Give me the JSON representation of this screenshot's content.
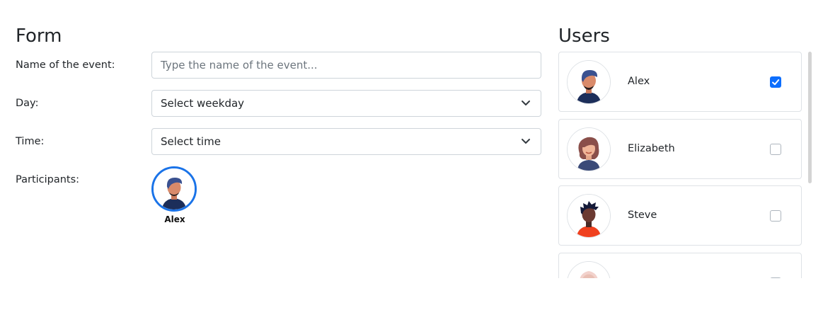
{
  "form": {
    "title": "Form",
    "event_name": {
      "label": "Name of the event:",
      "placeholder": "Type the name of the event...",
      "value": ""
    },
    "day": {
      "label": "Day:",
      "selected": "Select weekday"
    },
    "time": {
      "label": "Time:",
      "selected": "Select time"
    },
    "participants": {
      "label": "Participants:",
      "items": [
        {
          "name": "Alex",
          "avatar": "male-avatar-icon"
        }
      ]
    }
  },
  "users": {
    "title": "Users",
    "items": [
      {
        "name": "Alex",
        "checked": true,
        "avatar": "male-avatar-icon"
      },
      {
        "name": "Elizabeth",
        "checked": false,
        "avatar": "female-avatar-icon"
      },
      {
        "name": "Steve",
        "checked": false,
        "avatar": "male-avatar-icon"
      },
      {
        "name": "",
        "checked": false,
        "avatar": "avatar-icon"
      }
    ]
  },
  "colors": {
    "accent": "#0d6efd",
    "participant_ring": "#1a73e8",
    "border": "#ced4da"
  }
}
